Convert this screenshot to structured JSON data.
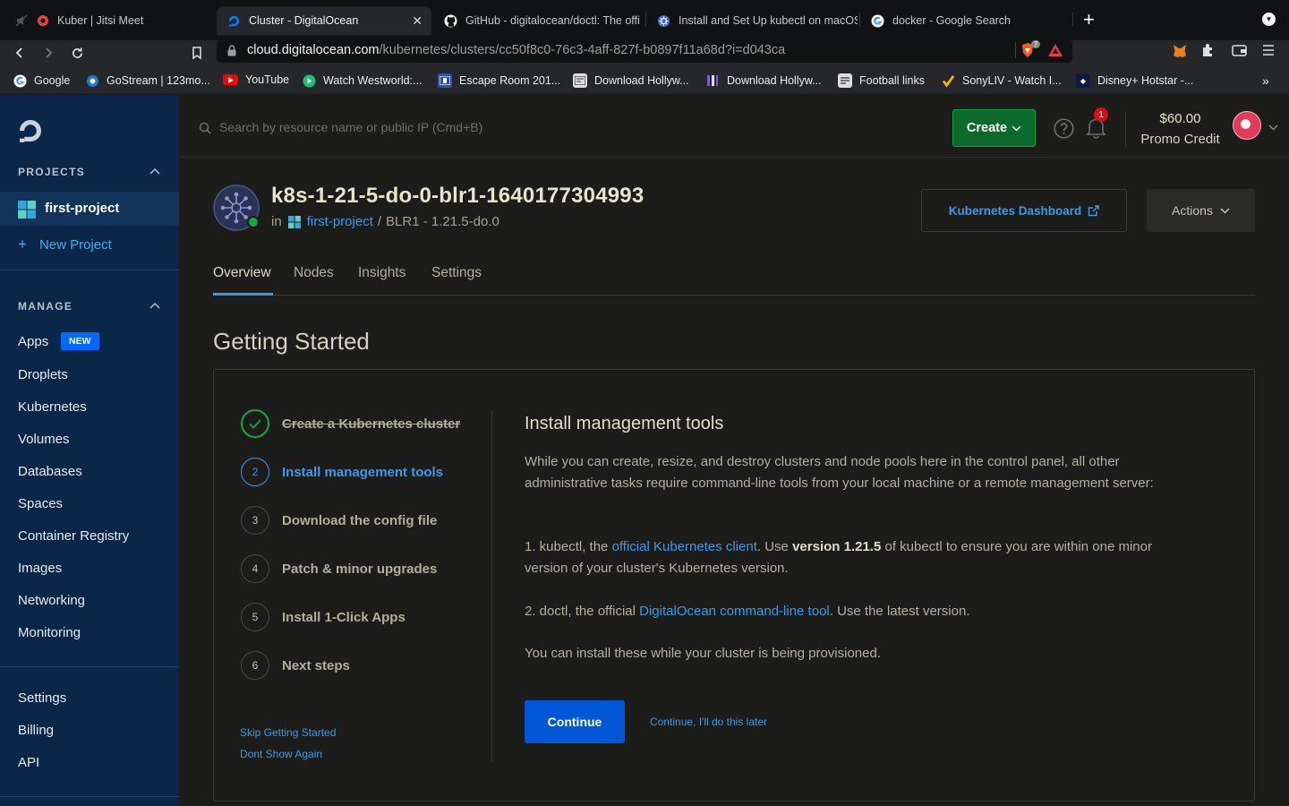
{
  "browser": {
    "tabs": [
      {
        "title": "Kuber | Jitsi Meet",
        "icon": "jitsi-icon"
      },
      {
        "title": "Cluster - DigitalOcean",
        "icon": "digitalocean-icon",
        "active": true
      },
      {
        "title": "GitHub - digitalocean/doctl: The offi",
        "icon": "github-icon"
      },
      {
        "title": "Install and Set Up kubectl on macOS",
        "icon": "kubernetes-icon"
      },
      {
        "title": "docker - Google Search",
        "icon": "google-icon"
      }
    ],
    "url_host": "cloud.digitalocean.com",
    "url_path": "/kubernetes/clusters/cc50f8c0-76c3-4aff-827f-b0897f11a68d?i=d043ca",
    "shield_count": "7",
    "bookmarks": [
      {
        "label": "Google",
        "icon": "google-icon"
      },
      {
        "label": "GoStream | 123mo...",
        "icon": "gostream-icon"
      },
      {
        "label": "YouTube",
        "icon": "youtube-icon"
      },
      {
        "label": "Watch Westworld:...",
        "icon": "play-icon"
      },
      {
        "label": "Escape Room 201...",
        "icon": "film-icon"
      },
      {
        "label": "Download Hollyw...",
        "icon": "film-icon"
      },
      {
        "label": "Download Hollyw...",
        "icon": "film-icon"
      },
      {
        "label": "Football links",
        "icon": "link-icon"
      },
      {
        "label": "SonyLIV - Watch I...",
        "icon": "check-icon"
      },
      {
        "label": "Disney+ Hotstar -...",
        "icon": "hotstar-icon"
      }
    ]
  },
  "sidebar": {
    "projects_heading": "PROJECTS",
    "current_project": "first-project",
    "new_project": "New Project",
    "manage_heading": "MANAGE",
    "apps_label": "Apps",
    "apps_badge": "NEW",
    "items": [
      "Droplets",
      "Kubernetes",
      "Volumes",
      "Databases",
      "Spaces",
      "Container Registry",
      "Images",
      "Networking",
      "Monitoring"
    ],
    "bottom_items": [
      "Settings",
      "Billing",
      "API"
    ]
  },
  "header": {
    "search_placeholder": "Search by resource name or public IP (Cmd+B)",
    "create_label": "Create",
    "notifications_count": "1",
    "credit_amount": "$60.00",
    "credit_label": "Promo Credit"
  },
  "cluster": {
    "name": "k8s-1-21-5-do-0-blr1-1640177304993",
    "in_label": "in",
    "project": "first-project",
    "location": "BLR1 - 1.21.5-do.0",
    "dashboard_label": "Kubernetes Dashboard",
    "actions_label": "Actions"
  },
  "page_tabs": [
    "Overview",
    "Nodes",
    "Insights",
    "Settings"
  ],
  "getting_started": {
    "title": "Getting Started",
    "steps": [
      {
        "num": "1",
        "label": "Create a Kubernetes cluster",
        "state": "done"
      },
      {
        "num": "2",
        "label": "Install management tools",
        "state": "current"
      },
      {
        "num": "3",
        "label": "Download the config file",
        "state": "todo"
      },
      {
        "num": "4",
        "label": "Patch & minor upgrades",
        "state": "todo"
      },
      {
        "num": "5",
        "label": "Install 1-Click Apps",
        "state": "todo"
      },
      {
        "num": "6",
        "label": "Next steps",
        "state": "todo"
      }
    ],
    "skip_label": "Skip Getting Started",
    "dont_show_label": "Dont Show Again",
    "step_title": "Install management tools",
    "intro": "While you can create, resize, and destroy clusters and node pools here in the control panel, all other administrative tasks require command-line tools from your local machine or a remote management server:",
    "item1_prefix": "1. kubectl, the ",
    "item1_link": "official Kubernetes client",
    "item1_mid": ". Use ",
    "item1_bold": "version 1.21.5",
    "item1_suffix": " of kubectl to ensure you are within one minor version of your cluster's Kubernetes version.",
    "item2_prefix": "2. doctl, the official ",
    "item2_link": "DigitalOcean command-line tool",
    "item2_suffix": ". Use the latest version.",
    "note": "You can install these while your cluster is being provisioned.",
    "continue_label": "Continue",
    "later_label": "Continue, I'll do this later"
  },
  "colors": {
    "accent_blue": "#3b9be8",
    "sidebar_bg": "#0a2648",
    "create_green": "#0c6b2c",
    "continue_blue": "#0058d6"
  }
}
